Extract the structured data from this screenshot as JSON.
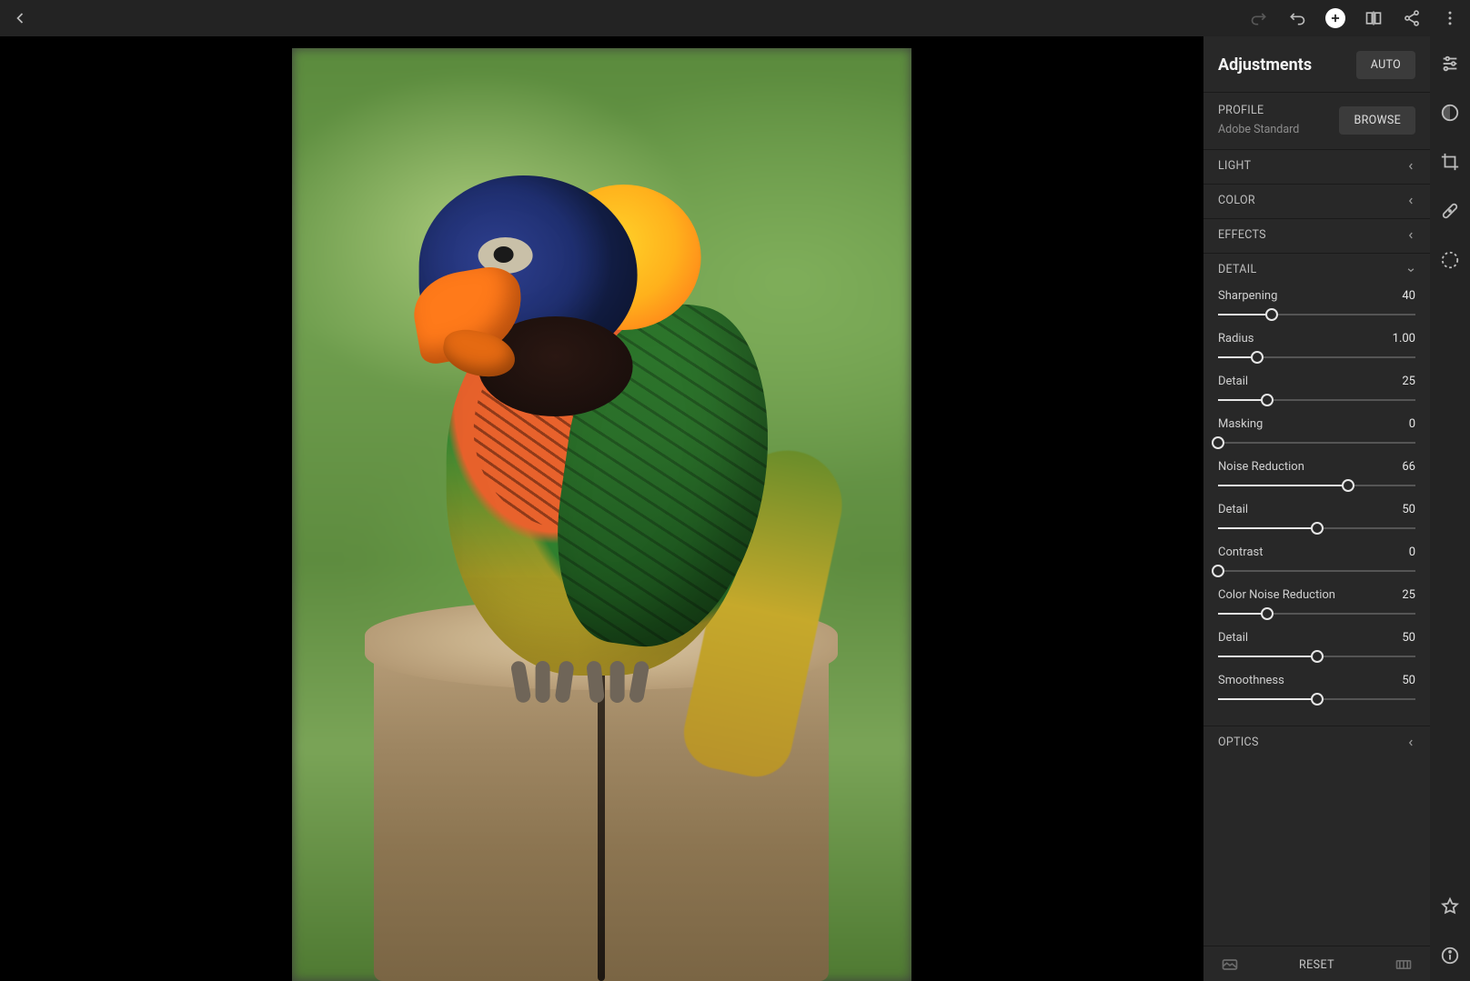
{
  "topbar": {
    "back": "Back",
    "redo": "Redo",
    "undo": "Undo",
    "add": "Add photo",
    "compare": "Before/After",
    "share": "Share",
    "menu": "More"
  },
  "panel": {
    "title": "Adjustments",
    "auto_label": "AUTO",
    "profile": {
      "label": "PROFILE",
      "value": "Adobe Standard",
      "browse": "BROWSE"
    },
    "sections": {
      "light": "LIGHT",
      "color": "COLOR",
      "effects": "EFFECTS",
      "detail": "DETAIL",
      "optics": "OPTICS"
    },
    "detail_sliders": [
      {
        "name": "Sharpening",
        "value": "40",
        "pct": 27
      },
      {
        "name": "Radius",
        "value": "1.00",
        "pct": 20
      },
      {
        "name": "Detail",
        "value": "25",
        "pct": 25
      },
      {
        "name": "Masking",
        "value": "0",
        "pct": 0
      },
      {
        "name": "Noise Reduction",
        "value": "66",
        "pct": 66
      },
      {
        "name": "Detail",
        "value": "50",
        "pct": 50
      },
      {
        "name": "Contrast",
        "value": "0",
        "pct": 0
      },
      {
        "name": "Color Noise Reduction",
        "value": "25",
        "pct": 25
      },
      {
        "name": "Detail",
        "value": "50",
        "pct": 50
      },
      {
        "name": "Smoothness",
        "value": "50",
        "pct": 50
      }
    ],
    "reset": "RESET"
  },
  "rail": {
    "adjust": "Adjust",
    "tone": "Tone curve",
    "crop": "Crop",
    "heal": "Healing",
    "mask": "Masking",
    "star": "Rating",
    "info": "Info"
  }
}
